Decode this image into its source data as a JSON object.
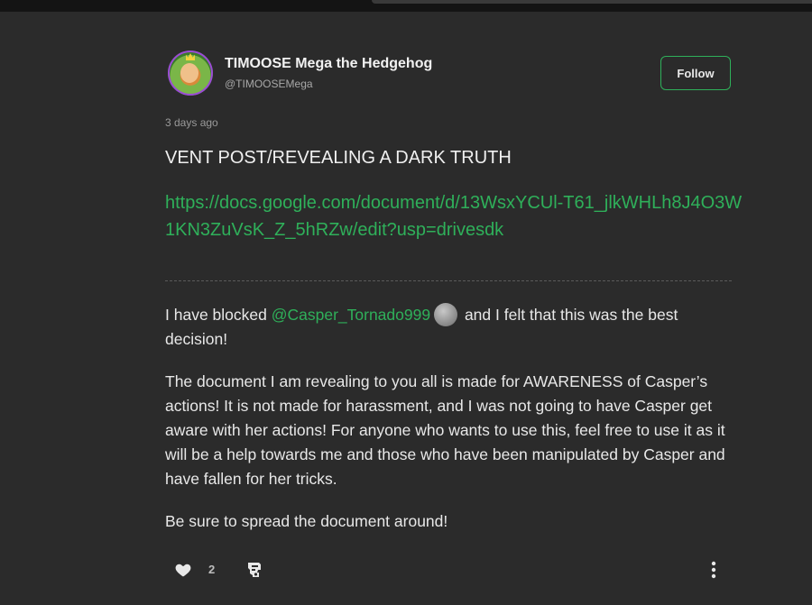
{
  "header": {
    "author_name": "TIMOOSE Mega the Hedgehog",
    "author_handle": "@TIMOOSEMega",
    "follow_label": "Follow"
  },
  "post": {
    "timestamp": "3 days ago",
    "title": "VENT POST/REVEALING A DARK TRUTH",
    "link": "https://docs.google.com/document/d/13WsxYCUl-T61_jlkWHLh8J4O3W1KN3ZuVsK_Z_5hRZw/edit?usp=drivesdk",
    "p1_before": "I have blocked ",
    "p1_mention": "@Casper_Tornado999",
    "p1_after": " and I felt that this was the best decision!",
    "p2": "The document I am revealing to you all is made for AWARENESS of Casper’s actions! It is not made for harassment, and I was not going to have Casper get aware with her actions! For anyone who wants to use this, feel free to use it as it will be a help towards me and those who have been manipulated by Casper and have fallen for her tricks.",
    "p3": "Be sure to spread the document around!"
  },
  "actions": {
    "like_count": "2",
    "icons": [
      "heart-icon",
      "reblog-icon",
      "more-vertical-icon"
    ]
  },
  "colors": {
    "background": "#2b2b2b",
    "accent_green": "#2fb05a",
    "text": "#e8e8e8",
    "muted": "#9a9a9a"
  }
}
